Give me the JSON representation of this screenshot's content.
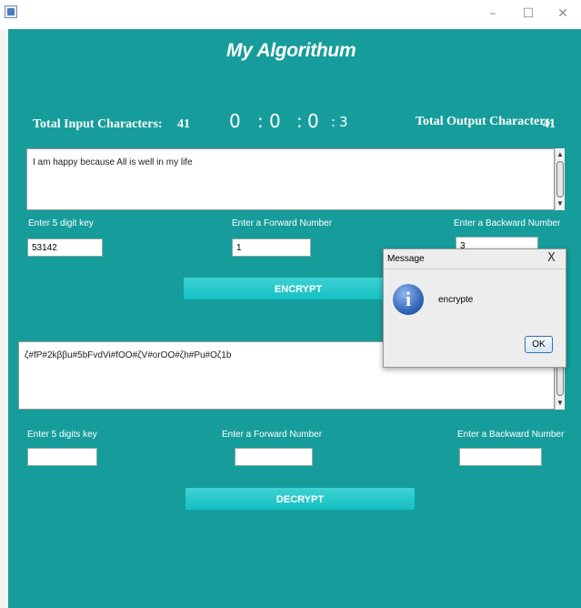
{
  "window": {
    "icon": "java-app-icon",
    "minimize_glyph": "–",
    "maximize_glyph": "☐",
    "close_glyph": "✕"
  },
  "app": {
    "title": "My Algorithum",
    "background": "#169d9b"
  },
  "stats": {
    "input_label": "Total Input Characters:",
    "input_count": "41",
    "output_label": "Total Output Characters:",
    "output_count": "41"
  },
  "timer": {
    "part1": "0",
    "sep1": ":",
    "part2": "0",
    "sep2": ":",
    "part3": "0",
    "sep3": ":",
    "part4": "3"
  },
  "encrypt": {
    "input_text": "I am happy because All is well in my life",
    "key_label": "Enter 5 digit key",
    "key_value": "53142",
    "forward_label": "Enter a Forward Number",
    "forward_value": "1",
    "backward_label": "Enter a Backward Number",
    "backward_value": "3",
    "button_label": "ENCRYPT"
  },
  "decrypt": {
    "output_text": "ζ#fP#2kββu#5bFvdVi#fOO#ζV#orOO#ζh#Pu#Oζ1b",
    "key_label": "Enter 5 digits key",
    "key_value": "",
    "forward_label": "Enter a Forward Number",
    "forward_value": "",
    "backward_label": "Enter a Backward Number",
    "backward_value": "",
    "button_label": "DECRYPT"
  },
  "dialog": {
    "title": "Message",
    "close_glyph": "X",
    "icon": "info-icon",
    "icon_glyph": "i",
    "message": "encrypte",
    "ok_label": "OK"
  }
}
